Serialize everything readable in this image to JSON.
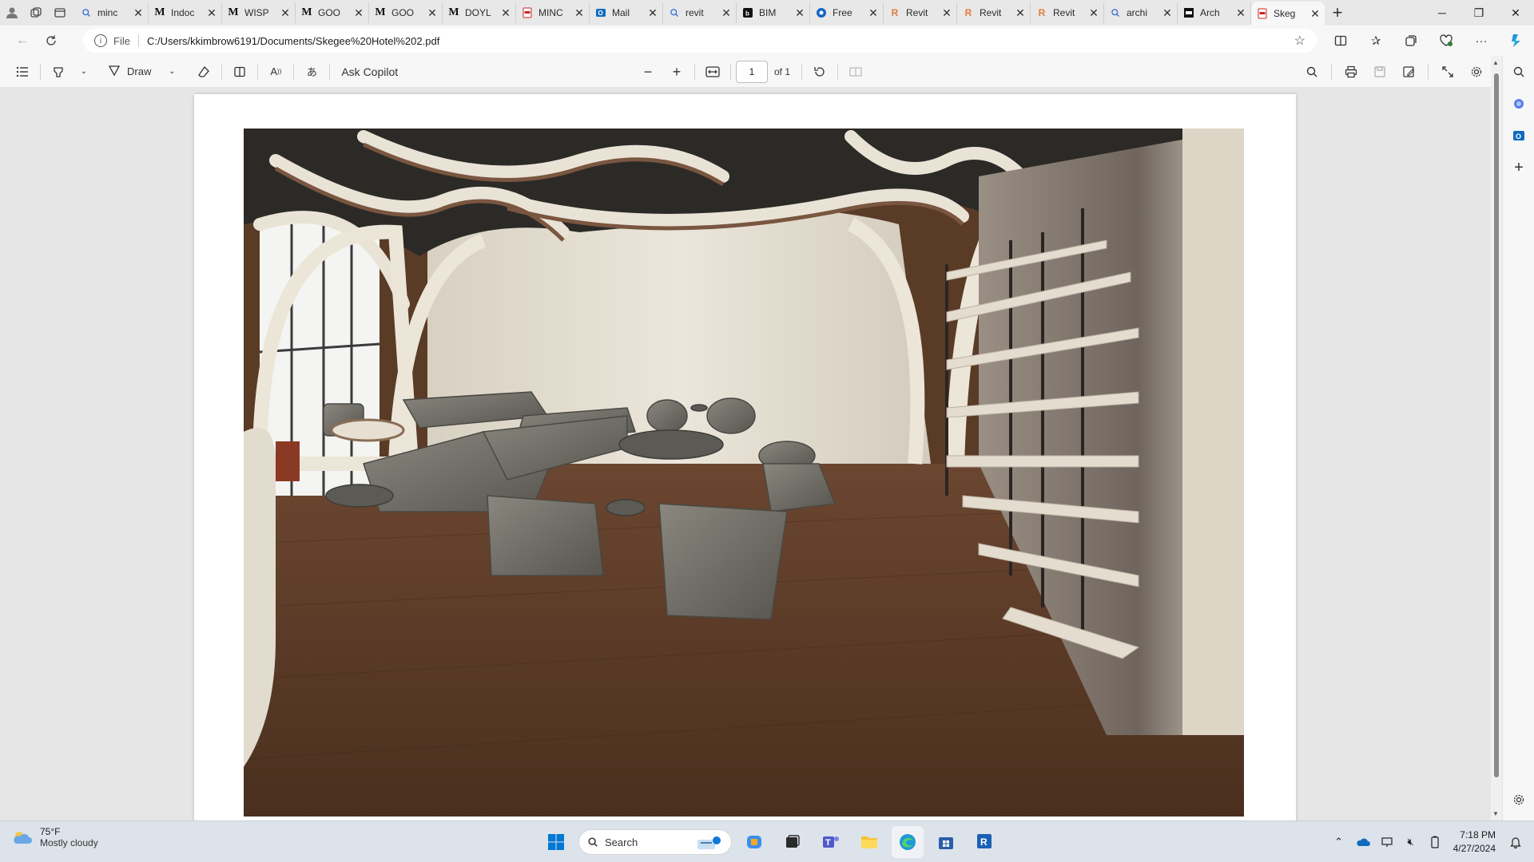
{
  "browser": {
    "tabs": [
      {
        "icon": "search-icon",
        "title": "minc"
      },
      {
        "icon": "medium-icon",
        "title": "Indoc"
      },
      {
        "icon": "medium-icon",
        "title": "WISP"
      },
      {
        "icon": "medium-icon",
        "title": "GOO"
      },
      {
        "icon": "medium-icon",
        "title": "GOO"
      },
      {
        "icon": "medium-icon",
        "title": "DOYL"
      },
      {
        "icon": "pdf-icon",
        "title": "MINC"
      },
      {
        "icon": "outlook-icon",
        "title": "Mail"
      },
      {
        "icon": "search-icon",
        "title": "revit"
      },
      {
        "icon": "bim-icon",
        "title": "BIM"
      },
      {
        "icon": "free-icon",
        "title": "Free"
      },
      {
        "icon": "revit-icon",
        "title": "Revit"
      },
      {
        "icon": "revit-icon",
        "title": "Revit"
      },
      {
        "icon": "revit-icon",
        "title": "Revit"
      },
      {
        "icon": "search-icon",
        "title": "archi"
      },
      {
        "icon": "archdaily-icon",
        "title": "Arch"
      },
      {
        "icon": "pdf-icon",
        "title": "Skeg",
        "active": true
      }
    ],
    "address": {
      "scheme": "File",
      "url": "C:/Users/kkimbrow6191/Documents/Skegee%20Hotel%202.pdf"
    }
  },
  "pdf_toolbar": {
    "draw_label": "Draw",
    "copilot_label": "Ask Copilot",
    "page_current": "1",
    "page_total": "of 1"
  },
  "taskbar": {
    "weather_temp": "75°F",
    "weather_desc": "Mostly cloudy",
    "search_label": "Search",
    "time": "7:18 PM",
    "date": "4/27/2024"
  },
  "colors": {
    "floor": "#5a3b26",
    "ceiling": "#2c2a27",
    "wall": "#e3ddcf",
    "accent": "#0067c0"
  }
}
